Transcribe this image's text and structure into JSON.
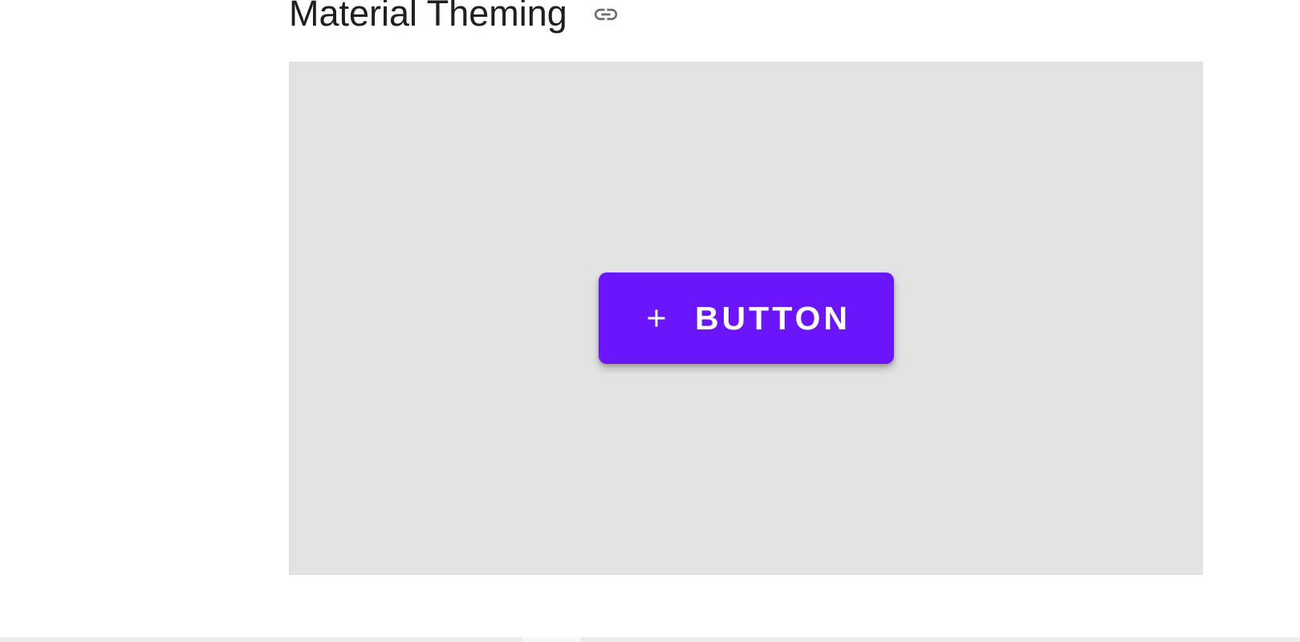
{
  "section": {
    "title": "Material Theming",
    "anchor_icon": "link-icon"
  },
  "demo": {
    "button_label": "Button",
    "button_icon": "plus-icon",
    "colors": {
      "button_bg": "#6b15fd",
      "button_text": "#ffffff",
      "canvas_bg": "#e3e3e4"
    }
  }
}
